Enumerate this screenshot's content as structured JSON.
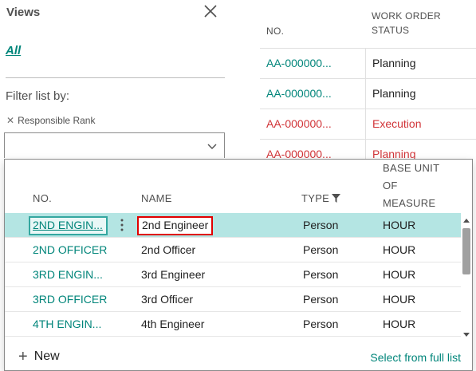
{
  "views": {
    "title": "Views",
    "all_label": "All",
    "filter_label": "Filter list by:",
    "filter_chip": "Responsible Rank",
    "filter_value": ""
  },
  "background_table": {
    "headers": {
      "no": "NO.",
      "status_line1": "WORK ORDER",
      "status_line2": "STATUS"
    },
    "rows": [
      {
        "no": "AA-000000...",
        "status": "Planning",
        "color": "#00857a",
        "status_color": "#212121"
      },
      {
        "no": "AA-000000...",
        "status": "Planning",
        "color": "#00857a",
        "status_color": "#212121"
      },
      {
        "no": "AA-000000...",
        "status": "Execution",
        "color": "#d13438",
        "status_color": "#d13438"
      },
      {
        "no": "AA-000000...",
        "status": "Planning",
        "color": "#d13438",
        "status_color": "#d13438"
      }
    ]
  },
  "lookup": {
    "headers": {
      "no": "NO.",
      "name": "NAME",
      "type": "TYPE",
      "uom_line1": "BASE UNIT",
      "uom_line2": "OF",
      "uom_line3": "MEASURE"
    },
    "rows": [
      {
        "no": "2ND ENGIN...",
        "name": "2nd Engineer",
        "type": "Person",
        "uom": "HOUR"
      },
      {
        "no": "2ND OFFICER",
        "name": "2nd Officer",
        "type": "Person",
        "uom": "HOUR"
      },
      {
        "no": "3RD ENGIN...",
        "name": "3rd Engineer",
        "type": "Person",
        "uom": "HOUR"
      },
      {
        "no": "3RD OFFICER",
        "name": "3rd Officer",
        "type": "Person",
        "uom": "HOUR"
      },
      {
        "no": "4TH ENGIN...",
        "name": "4th Engineer",
        "type": "Person",
        "uom": "HOUR"
      }
    ],
    "new_label": "New",
    "select_full_label": "Select from full list"
  },
  "colors": {
    "accent": "#00857a",
    "selected_row": "#b4e5e3",
    "error": "#d13438"
  }
}
